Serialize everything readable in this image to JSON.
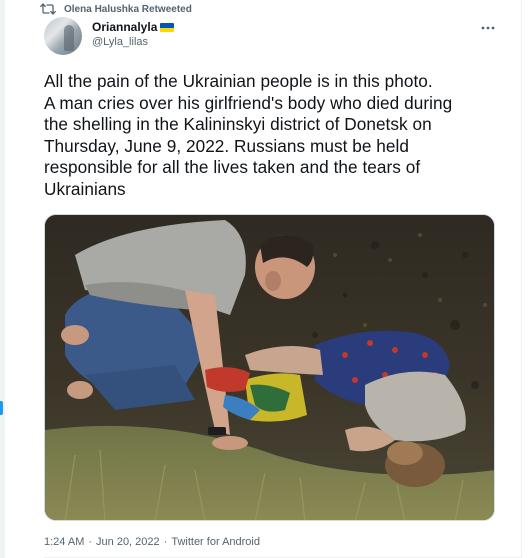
{
  "retweet": {
    "label": "Olena Halushka Retweeted",
    "icon": "retweet-icon"
  },
  "author": {
    "display_name": "Oriannalyla",
    "flag": "ukraine-flag-icon",
    "handle": "@Lyla_lilas",
    "avatar_icon": "avatar"
  },
  "tweet": {
    "lines": [
      "All the pain of the Ukrainian people is in this photo.",
      "A man cries over his girlfriend's body who died during",
      "the shelling in the Kalininskyi district of Donetsk on",
      "Thursday, June 9, 2022. Russians must be held",
      "responsible for all the lives taken and the tears of",
      "Ukrainians"
    ],
    "media": {
      "kind": "photo"
    }
  },
  "meta": {
    "time": "1:24 AM",
    "separator": "·",
    "date": "Jun 20, 2022",
    "source": "Twitter for Android"
  },
  "colors": {
    "text_primary": "#0f1419",
    "text_secondary": "#536471",
    "accent": "#1d9bf0",
    "flag_blue": "#0057b7",
    "flag_yellow": "#ffd700"
  }
}
